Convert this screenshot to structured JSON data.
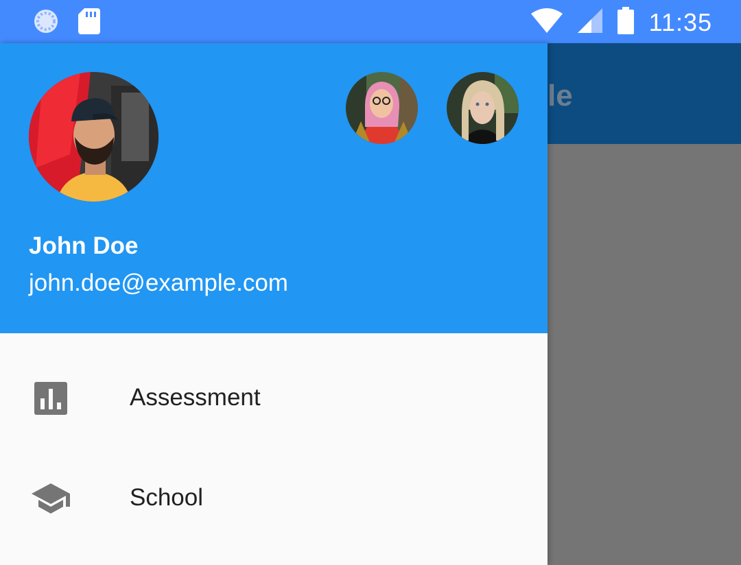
{
  "status_bar": {
    "time": "11:35",
    "icons": [
      "loading-circle-icon",
      "sd-card-icon",
      "wifi-icon",
      "cellular-signal-icon",
      "battery-icon"
    ]
  },
  "app_bar": {
    "title_fragment": "le"
  },
  "drawer": {
    "header": {
      "background": "#2196f3",
      "account_name": "John Doe",
      "account_email": "john.doe@example.com"
    },
    "items": [
      {
        "label": "Assessment",
        "icon": "bar-chart-icon"
      },
      {
        "label": "School",
        "icon": "school-icon"
      }
    ]
  },
  "colors": {
    "status_bar": "#448aff",
    "header": "#2196f3",
    "scrim": "#757575",
    "drawer_bg": "#fafafa",
    "icon": "#757575",
    "text": "#212121"
  }
}
